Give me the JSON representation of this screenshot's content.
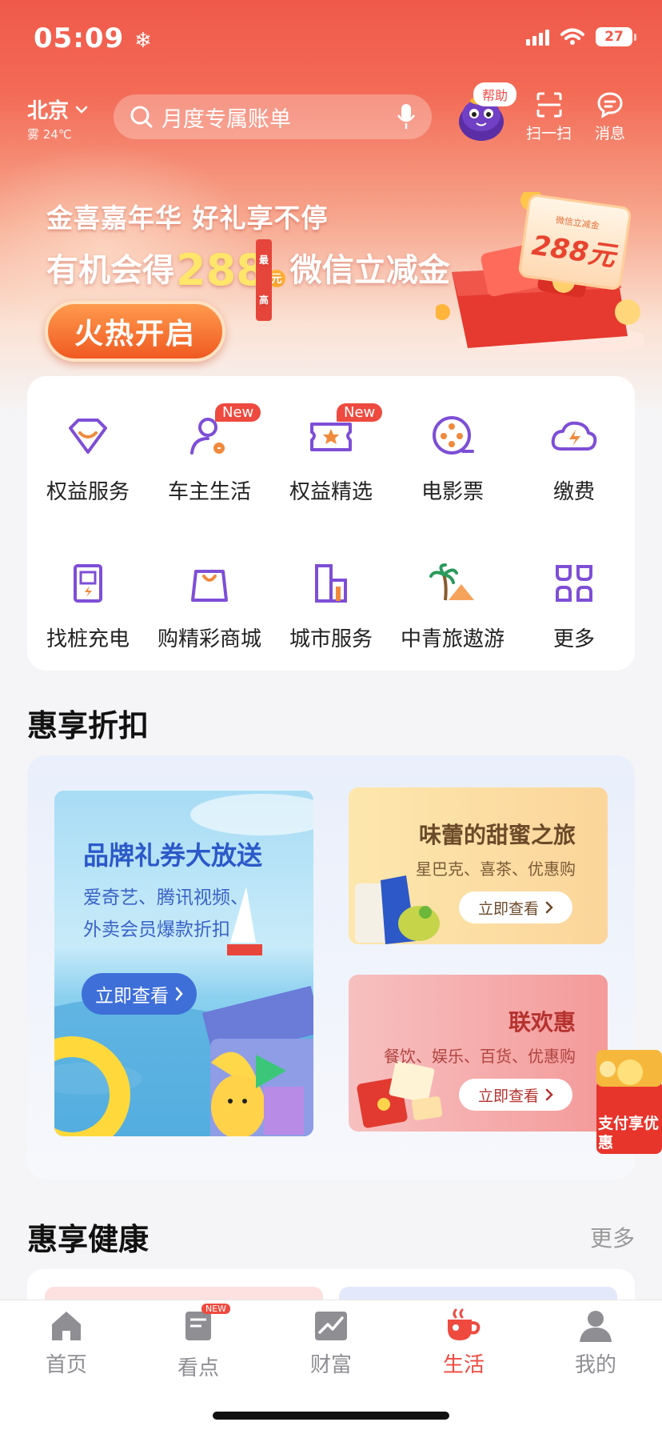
{
  "status": {
    "time": "05:09",
    "battery": "27"
  },
  "header": {
    "city": "北京",
    "weather": "雾 24℃",
    "search_placeholder": "月度专属账单",
    "help_label": "帮助",
    "scan_label": "扫一扫",
    "message_label": "消息"
  },
  "banner": {
    "line1": "金喜嘉年华 好礼享不停",
    "line2_prefix": "有机会得",
    "amount": "288",
    "amount_tag": "最高",
    "amount_unit": "元",
    "line2_suffix": "微信立减金",
    "button": "火热开启",
    "coupon_title": "微信立减金",
    "coupon_amount": "288元"
  },
  "services": [
    {
      "label": "权益服务",
      "icon": "diamond-heart-icon",
      "badge": ""
    },
    {
      "label": "车主生活",
      "icon": "car-owner-icon",
      "badge": "New"
    },
    {
      "label": "权益精选",
      "icon": "star-ticket-icon",
      "badge": "New"
    },
    {
      "label": "电影票",
      "icon": "film-reel-icon",
      "badge": ""
    },
    {
      "label": "缴费",
      "icon": "bolt-cloud-icon",
      "badge": ""
    },
    {
      "label": "找桩充电",
      "icon": "charging-pile-icon",
      "badge": ""
    },
    {
      "label": "购精彩商城",
      "icon": "shopping-bag-icon",
      "badge": ""
    },
    {
      "label": "城市服务",
      "icon": "city-building-icon",
      "badge": ""
    },
    {
      "label": "中青旅遨游",
      "icon": "palm-tree-icon",
      "badge": ""
    },
    {
      "label": "更多",
      "icon": "more-grid-icon",
      "badge": ""
    }
  ],
  "discount": {
    "section_title": "惠享折扣",
    "big_card": {
      "title": "品牌礼券大放送",
      "desc_line1": "爱奇艺、腾讯视频、",
      "desc_line2": "外卖会员爆款折扣",
      "button": "立即查看"
    },
    "card_sweet": {
      "title": "味蕾的甜蜜之旅",
      "desc": "星巴克、喜茶、优惠购",
      "button": "立即查看"
    },
    "card_union": {
      "title": "联欢惠",
      "desc": "餐饮、娱乐、百货、优惠购",
      "button": "立即查看"
    },
    "floating_label": "支付享优惠"
  },
  "health": {
    "section_title": "惠享健康",
    "more": "更多"
  },
  "tabbar": {
    "items": [
      {
        "label": "首页",
        "icon": "home-icon",
        "active": false
      },
      {
        "label": "看点",
        "icon": "news-icon",
        "active": false,
        "badge": "NEW"
      },
      {
        "label": "财富",
        "icon": "wealth-chart-icon",
        "active": false
      },
      {
        "label": "生活",
        "icon": "coffee-cup-icon",
        "active": true
      },
      {
        "label": "我的",
        "icon": "profile-icon",
        "active": false
      }
    ]
  },
  "colors": {
    "brand_red": "#ee4a3f",
    "icon_purple": "#7e4ed6",
    "tab_inactive": "#8e8e93"
  }
}
